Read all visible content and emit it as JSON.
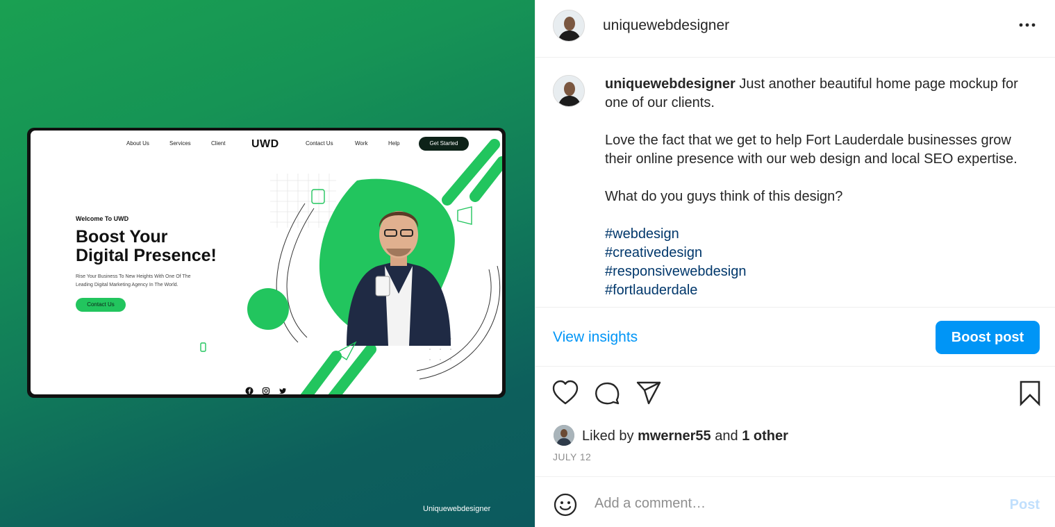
{
  "media": {
    "watermark": "Uniquewebdesigner",
    "mockup": {
      "nav_left": [
        "About Us",
        "Services",
        "Client"
      ],
      "logo": "UWD",
      "nav_right": [
        "Contact Us",
        "Work",
        "Help"
      ],
      "top_cta": "Get Started",
      "welcome": "Welcome To UWD",
      "headline_line1": "Boost Your",
      "headline_line2": "Digital Presence!",
      "subtext_line1": "Rise Your Business To New Heights With One Of The",
      "subtext_line2": "Leading Digital Marketing Agency In The World.",
      "hero_button": "Contact Us",
      "social_icons": [
        "facebook-icon",
        "instagram-icon",
        "twitter-icon"
      ],
      "accent_color": "#22c55e"
    }
  },
  "post": {
    "username": "uniquewebdesigner",
    "caption": {
      "username": "uniquewebdesigner",
      "line1": "Just another beautiful home page mockup for one of our clients.",
      "para2": "Love the fact that we get to help Fort Lauderdale businesses grow their online presence with our web design and local SEO expertise.",
      "para3": "What do you guys think of this design?",
      "hashtags": [
        "#webdesign",
        "#creativedesign",
        "#responsivewebdesign",
        "#fortlauderdale"
      ]
    },
    "insights_label": "View insights",
    "boost_label": "Boost post",
    "likes": {
      "prefix": "Liked by",
      "user": "mwerner55",
      "joiner": "and",
      "others": "1 other"
    },
    "date": "JULY 12",
    "comment": {
      "placeholder": "Add a comment…",
      "post_label": "Post"
    },
    "colors": {
      "link_blue": "#0095f6",
      "hashtag": "#00376b",
      "muted": "#8e8e8e"
    }
  }
}
